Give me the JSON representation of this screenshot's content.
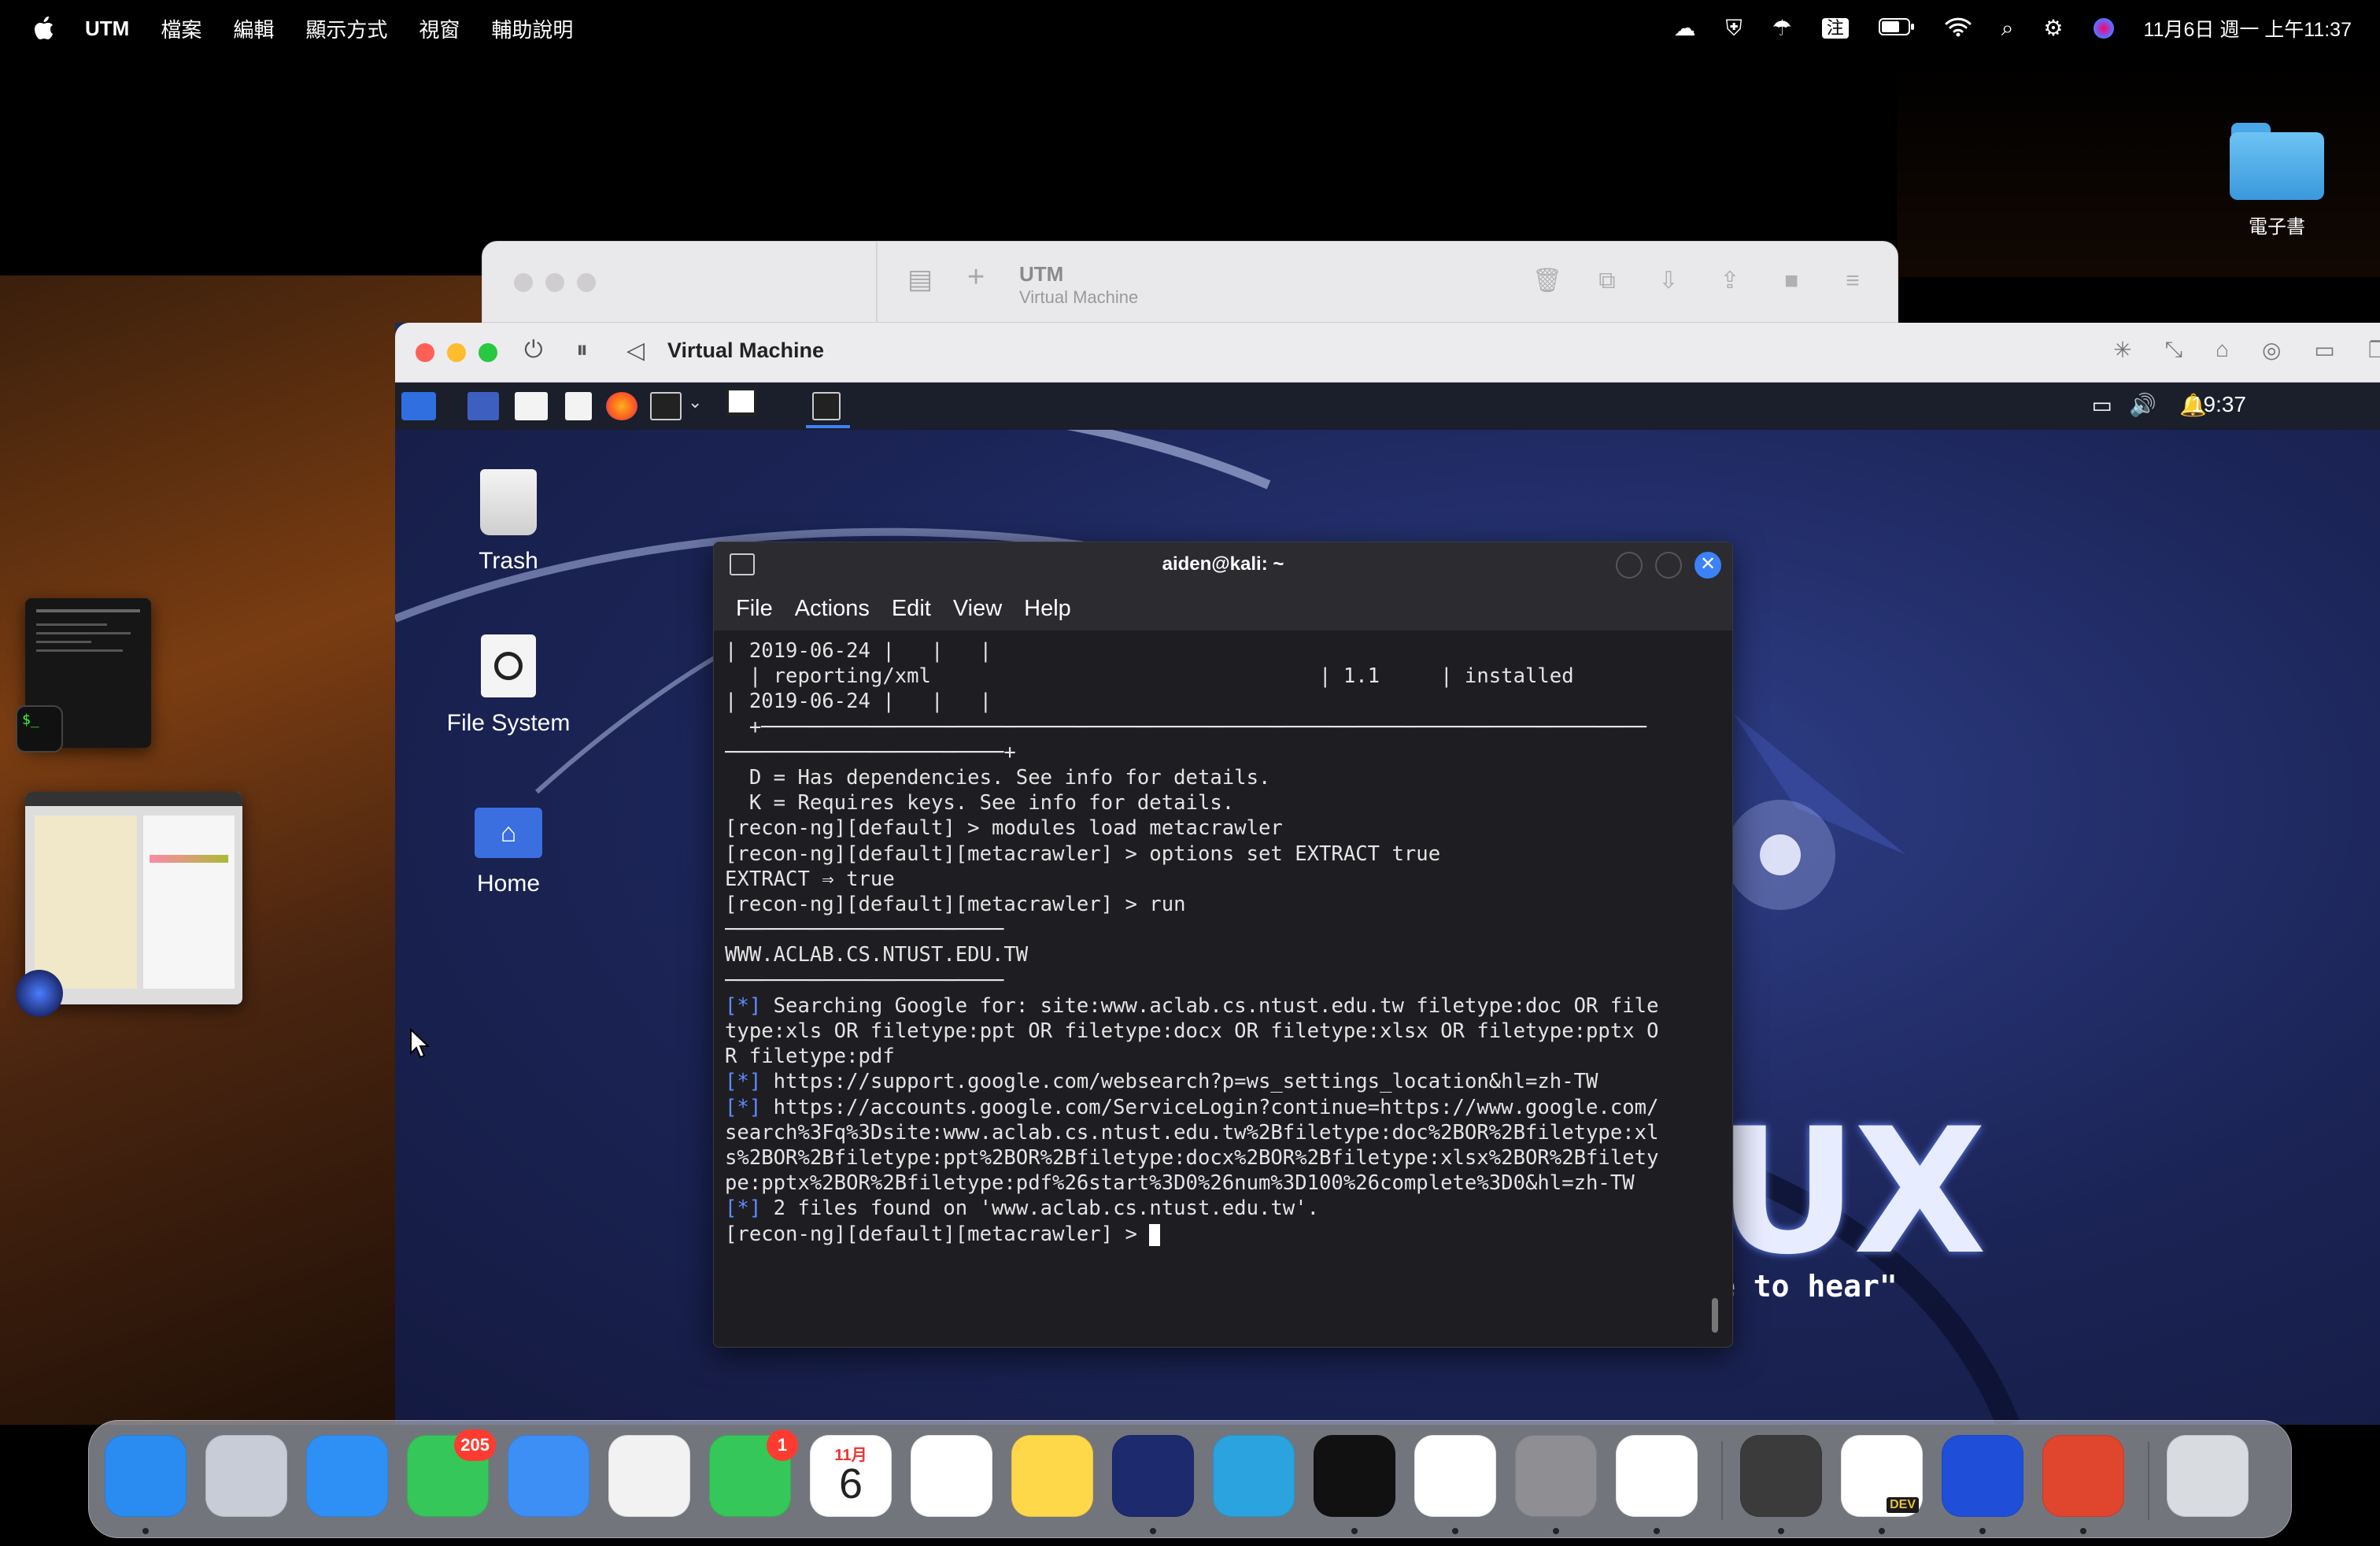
{
  "menubar": {
    "app_name": "UTM",
    "items": [
      "檔案",
      "編輯",
      "顯示方式",
      "視窗",
      "輔助說明"
    ],
    "clock": "11月6日 週一 上午11:37",
    "input_method": "注"
  },
  "desktop": {
    "folder_label": "電子書"
  },
  "utm_window": {
    "title": "UTM",
    "subtitle": "Virtual Machine"
  },
  "vm_window": {
    "title": "Virtual Machine"
  },
  "kali": {
    "clock": "19:37",
    "desktop_icons": [
      "Trash",
      "File System",
      "Home"
    ],
    "wallpaper_text": "UX",
    "wallpaper_quote": "e to hear\""
  },
  "terminal": {
    "title": "aiden@kali: ~",
    "menu": [
      "File",
      "Actions",
      "Edit",
      "View",
      "Help"
    ],
    "lines": [
      "| 2019-06-24 |   |   |",
      "  | reporting/xml                                | 1.1     | installed",
      "| 2019-06-24 |   |   |",
      "  +─────────────────────────────────────────────────────────────────────────",
      "───────────────────────+",
      "",
      "  D = Has dependencies. See info for details.",
      "  K = Requires keys. See info for details.",
      "",
      "[recon-ng][default] > modules load metacrawler",
      "[recon-ng][default][metacrawler] > options set EXTRACT true",
      "EXTRACT ⇒ true",
      "[recon-ng][default][metacrawler] > run",
      "",
      "───────────────────────",
      "WWW.ACLAB.CS.NTUST.EDU.TW",
      "───────────────────────",
      "[*] Searching Google for: site:www.aclab.cs.ntust.edu.tw filetype:doc OR file",
      "type:xls OR filetype:ppt OR filetype:docx OR filetype:xlsx OR filetype:pptx O",
      "R filetype:pdf",
      "[*] https://support.google.com/websearch?p=ws_settings_location&hl=zh-TW",
      "[*] https://accounts.google.com/ServiceLogin?continue=https://www.google.com/",
      "search%3Fq%3Dsite:www.aclab.cs.ntust.edu.tw%2Bfiletype:doc%2BOR%2Bfiletype:xl",
      "s%2BOR%2Bfiletype:ppt%2BOR%2Bfiletype:docx%2BOR%2Bfiletype:xlsx%2BOR%2Bfilety",
      "pe:pptx%2BOR%2Bfiletype:pdf%26start%3D0%26num%3D100%26complete%3D0&hl=zh-TW",
      "[*] 2 files found on 'www.aclab.cs.ntust.edu.tw'.",
      "[recon-ng][default][metacrawler] > "
    ]
  },
  "dock": {
    "apps": [
      {
        "name": "Finder",
        "color": "#2a8cf0"
      },
      {
        "name": "Launchpad",
        "color": "#c8ccd6"
      },
      {
        "name": "Safari",
        "color": "#2e90f5"
      },
      {
        "name": "Messages",
        "color": "#35c759",
        "badge": "205"
      },
      {
        "name": "Mail",
        "color": "#3d8ef5"
      },
      {
        "name": "Photos",
        "color": "#f2f2f2"
      },
      {
        "name": "FaceTime",
        "color": "#35c759",
        "badge": "1"
      },
      {
        "name": "Calendar",
        "color": "#ffffff",
        "month": "11月",
        "day": "6"
      },
      {
        "name": "Reminders",
        "color": "#ffffff"
      },
      {
        "name": "Notes",
        "color": "#ffd84a"
      },
      {
        "name": "Firefox",
        "color": "#1d2a6e"
      },
      {
        "name": "Telegram",
        "color": "#2aa3df"
      },
      {
        "name": "Terminal",
        "color": "#111111"
      },
      {
        "name": "VS Code",
        "color": "#ffffff"
      },
      {
        "name": "System Settings",
        "color": "#8e8e93"
      },
      {
        "name": "Word",
        "color": "#ffffff"
      },
      {
        "name": "Sublime Text",
        "color": "#3b3b3b"
      },
      {
        "name": "Edge Dev",
        "color": "#ffffff",
        "tag": "DEV"
      },
      {
        "name": "UTM",
        "color": "#1f4ed8"
      },
      {
        "name": "Remote Desktop",
        "color": "#e0452d"
      },
      {
        "name": "Trash",
        "color": "#d8dbe0"
      }
    ]
  }
}
